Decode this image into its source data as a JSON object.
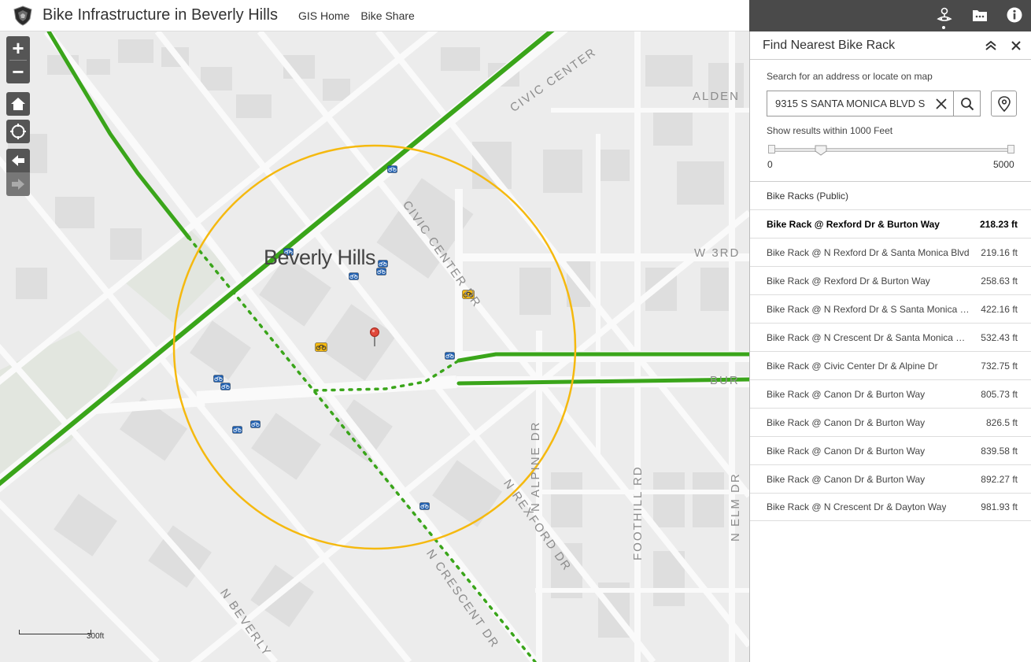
{
  "header": {
    "title": "Bike Infrastructure in Beverly Hills",
    "links": [
      "GIS Home",
      "Bike Share"
    ]
  },
  "toolbar": {
    "icons": [
      "directions-icon",
      "more-icon",
      "info-icon"
    ]
  },
  "map": {
    "city_label": "Beverly Hills",
    "streets": {
      "civic_center_top": "CIVIC CENTER",
      "civic_center_dr": "CIVIC CENTER DR",
      "alden": "ALDEN",
      "w3rd": "W 3RD",
      "burton": "BUR",
      "n_alpine": "N ALPINE DR",
      "n_rexford": "N REXFORD DR",
      "foothill": "FOOTHILL RD",
      "n_elm": "N ELM DR",
      "n_crescent": "N CRESCENT DR",
      "n_beverly": "N BEVERLY"
    },
    "scale_label": "300ft",
    "colors": {
      "bike_lane": "#3aa51a",
      "buffer": "#f5b90f",
      "rack_icon": "#1f5fb0",
      "share_icon": "#f5b90f"
    }
  },
  "panel": {
    "title": "Find Nearest Bike Rack",
    "search_instruction": "Search for an address or locate on map",
    "search_value": "9315 S SANTA MONICA BLVD S",
    "distance_label": "Show results within 1000 Feet",
    "slider": {
      "min": "0",
      "max": "5000",
      "value": 1000
    },
    "layer_title": "Bike Racks (Public)",
    "results": [
      {
        "name": "Bike Rack @ Rexford Dr & Burton Way",
        "distance": "218.23 ft"
      },
      {
        "name": "Bike Rack @ N Rexford Dr & Santa Monica Blvd",
        "distance": "219.16 ft"
      },
      {
        "name": "Bike Rack @ Rexford Dr & Burton Way",
        "distance": "258.63 ft"
      },
      {
        "name": "Bike Rack @ N Rexford Dr & S Santa Monica B...",
        "distance": "422.16 ft"
      },
      {
        "name": "Bike Rack @ N Crescent Dr & Santa Monica Bl...",
        "distance": "532.43 ft"
      },
      {
        "name": "Bike Rack @ Civic Center Dr & Alpine Dr",
        "distance": "732.75 ft"
      },
      {
        "name": "Bike Rack @ Canon Dr & Burton Way",
        "distance": "805.73 ft"
      },
      {
        "name": "Bike Rack @ Canon Dr & Burton Way",
        "distance": "826.5 ft"
      },
      {
        "name": "Bike Rack @ Canon Dr & Burton Way",
        "distance": "839.58 ft"
      },
      {
        "name": "Bike Rack @ Canon Dr & Burton Way",
        "distance": "892.27 ft"
      },
      {
        "name": "Bike Rack @ N Crescent Dr & Dayton Way",
        "distance": "981.93 ft"
      }
    ]
  }
}
